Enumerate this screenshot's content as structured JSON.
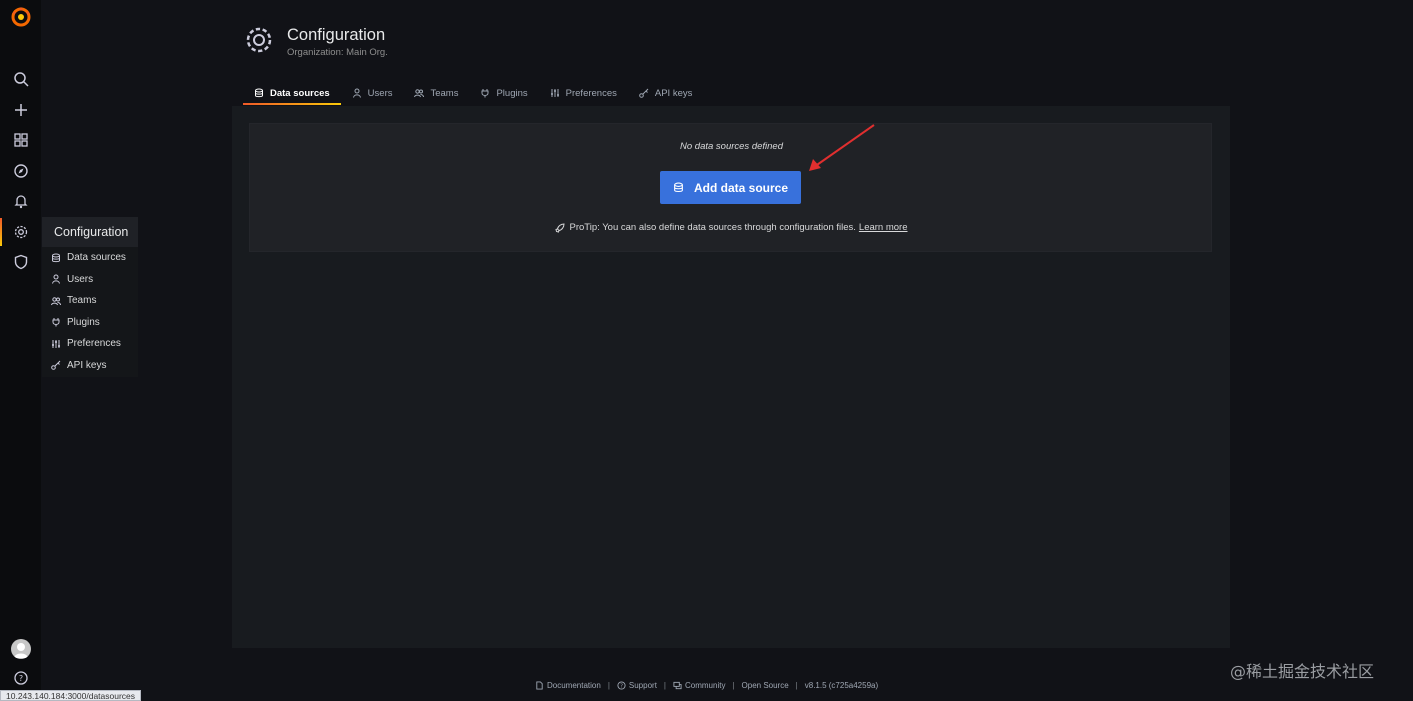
{
  "header": {
    "title": "Configuration",
    "subtitle": "Organization: Main Org."
  },
  "tabs": [
    {
      "label": "Data sources",
      "icon": "database-icon",
      "active": true
    },
    {
      "label": "Users",
      "icon": "user-icon",
      "active": false
    },
    {
      "label": "Teams",
      "icon": "users-icon",
      "active": false
    },
    {
      "label": "Plugins",
      "icon": "plug-icon",
      "active": false
    },
    {
      "label": "Preferences",
      "icon": "sliders-icon",
      "active": false
    },
    {
      "label": "API keys",
      "icon": "key-icon",
      "active": false
    }
  ],
  "sidebar": {
    "icons": [
      "grafana-logo",
      "search-icon",
      "plus-icon",
      "dashboards-icon",
      "explore-icon",
      "alert-bell-icon",
      "gear-icon",
      "shield-icon",
      "avatar",
      "help-icon"
    ],
    "flyout": {
      "title": "Configuration",
      "items": [
        {
          "label": "Data sources",
          "icon": "database-icon"
        },
        {
          "label": "Users",
          "icon": "user-icon"
        },
        {
          "label": "Teams",
          "icon": "users-icon"
        },
        {
          "label": "Plugins",
          "icon": "plug-icon"
        },
        {
          "label": "Preferences",
          "icon": "sliders-icon"
        },
        {
          "label": "API keys",
          "icon": "key-icon"
        }
      ]
    }
  },
  "empty_state": {
    "message": "No data sources defined",
    "button_label": "Add data source",
    "protip": "ProTip: You can also define data sources through configuration files.",
    "learn_more": "Learn more"
  },
  "footer": {
    "documentation": "Documentation",
    "support": "Support",
    "community": "Community",
    "open_source": "Open Source",
    "version": "v8.1.5 (c725a4259a)"
  },
  "status_url": "10.243.140.184:3000/datasources",
  "watermark": "@稀土掘金技术社区",
  "colors": {
    "background": "#111217",
    "sidebar": "#0b0c0e",
    "panel": "#181b1f",
    "primary_button": "#3871dc",
    "accent_gradient_start": "#f05a28",
    "accent_gradient_end": "#fbca0a",
    "annotation_arrow": "#e02f2f"
  }
}
